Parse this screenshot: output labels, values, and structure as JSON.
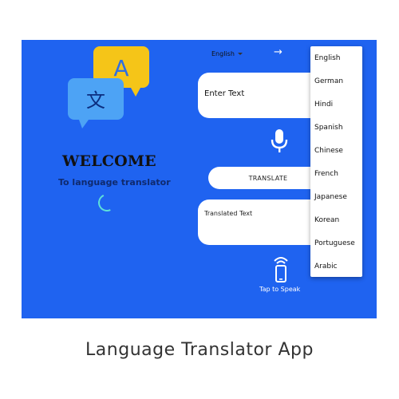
{
  "app": {
    "welcome": "WELCOME",
    "subtitle": "To language translator",
    "logo_letters": {
      "latin": "A",
      "cjk": "文"
    }
  },
  "toolbar": {
    "source_language": "English",
    "swap_arrow": "→"
  },
  "input": {
    "placeholder": "Enter Text"
  },
  "translate_button": "TRANSLATE",
  "output": {
    "placeholder": "Translated Text"
  },
  "speak": {
    "label": "Tap to Speak"
  },
  "language_menu": {
    "items": [
      "English",
      "German",
      "Hindi",
      "Spanish",
      "Chinese",
      "French",
      "Japanese",
      "Korean",
      "Portuguese",
      "Arabic"
    ]
  },
  "caption": "Language Translator App",
  "colors": {
    "background": "#1f63f0",
    "bubble_yellow": "#f5c518",
    "bubble_blue": "#4da3f5",
    "spinner": "#5ee0d9"
  }
}
